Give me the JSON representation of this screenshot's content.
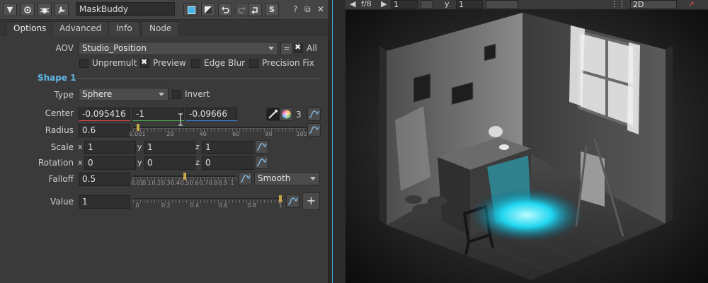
{
  "node": {
    "name": "MaskBuddy"
  },
  "window": {
    "help": "?",
    "float": "⧉",
    "close": "✕",
    "minimize": "▼"
  },
  "toolbar": {
    "s_button": "S"
  },
  "tabs": [
    "Options",
    "Advanced",
    "Info",
    "Node"
  ],
  "aov": {
    "label": "AOV",
    "value": "Studio_Position",
    "eq_button": "=",
    "all_label": "All",
    "all_checked": true
  },
  "options": [
    {
      "label": "Unpremult",
      "checked": false
    },
    {
      "label": "Preview",
      "checked": true
    },
    {
      "label": "Edge Blur",
      "checked": false
    },
    {
      "label": "Precision Fix",
      "checked": false
    }
  ],
  "shape": {
    "section_title": "Shape 1",
    "type": {
      "label": "Type",
      "value": "Sphere",
      "invert_label": "Invert",
      "invert_checked": false
    },
    "center": {
      "label": "Center",
      "x": "-0.095416",
      "y": "-1",
      "z": "-0.09666",
      "channel_count": "3"
    },
    "radius": {
      "label": "Radius",
      "value": "0.6",
      "ticks": [
        "0.001",
        "20",
        "40",
        "60",
        "80",
        "100"
      ],
      "level": 0.006
    },
    "scale": {
      "label": "Scale",
      "x": "1",
      "y": "1",
      "z": "1",
      "axis": [
        "x",
        "y",
        "z"
      ]
    },
    "rotation": {
      "label": "Rotation",
      "x": "0",
      "y": "0",
      "z": "0",
      "axis": [
        "x",
        "y",
        "z"
      ]
    },
    "falloff": {
      "label": "Falloff",
      "value": "0.5",
      "ticks": [
        "0.01",
        "0.1",
        "0.2",
        "0.3",
        "0.4",
        "0.5",
        "0.6",
        "0.7",
        "0.8",
        "0.9",
        "1"
      ],
      "level": 0.5,
      "mode": "Smooth"
    },
    "value": {
      "label": "Value",
      "value": "1",
      "ticks": [
        "0",
        "0.2",
        "0.4",
        "0.6",
        "0.8",
        "1"
      ],
      "level": 1.0,
      "add_button": "+"
    }
  },
  "viewer": {
    "fstop": "f/8",
    "frame": "1",
    "y_label": "y",
    "y_value": "1",
    "view_mode": "2D"
  },
  "colors": {
    "accent": "#47b4e8",
    "mask": "#1fd6f0",
    "red": "#d64646",
    "green": "#4ea64e",
    "blue": "#3a7bd5",
    "section": "#5fb8e6"
  }
}
